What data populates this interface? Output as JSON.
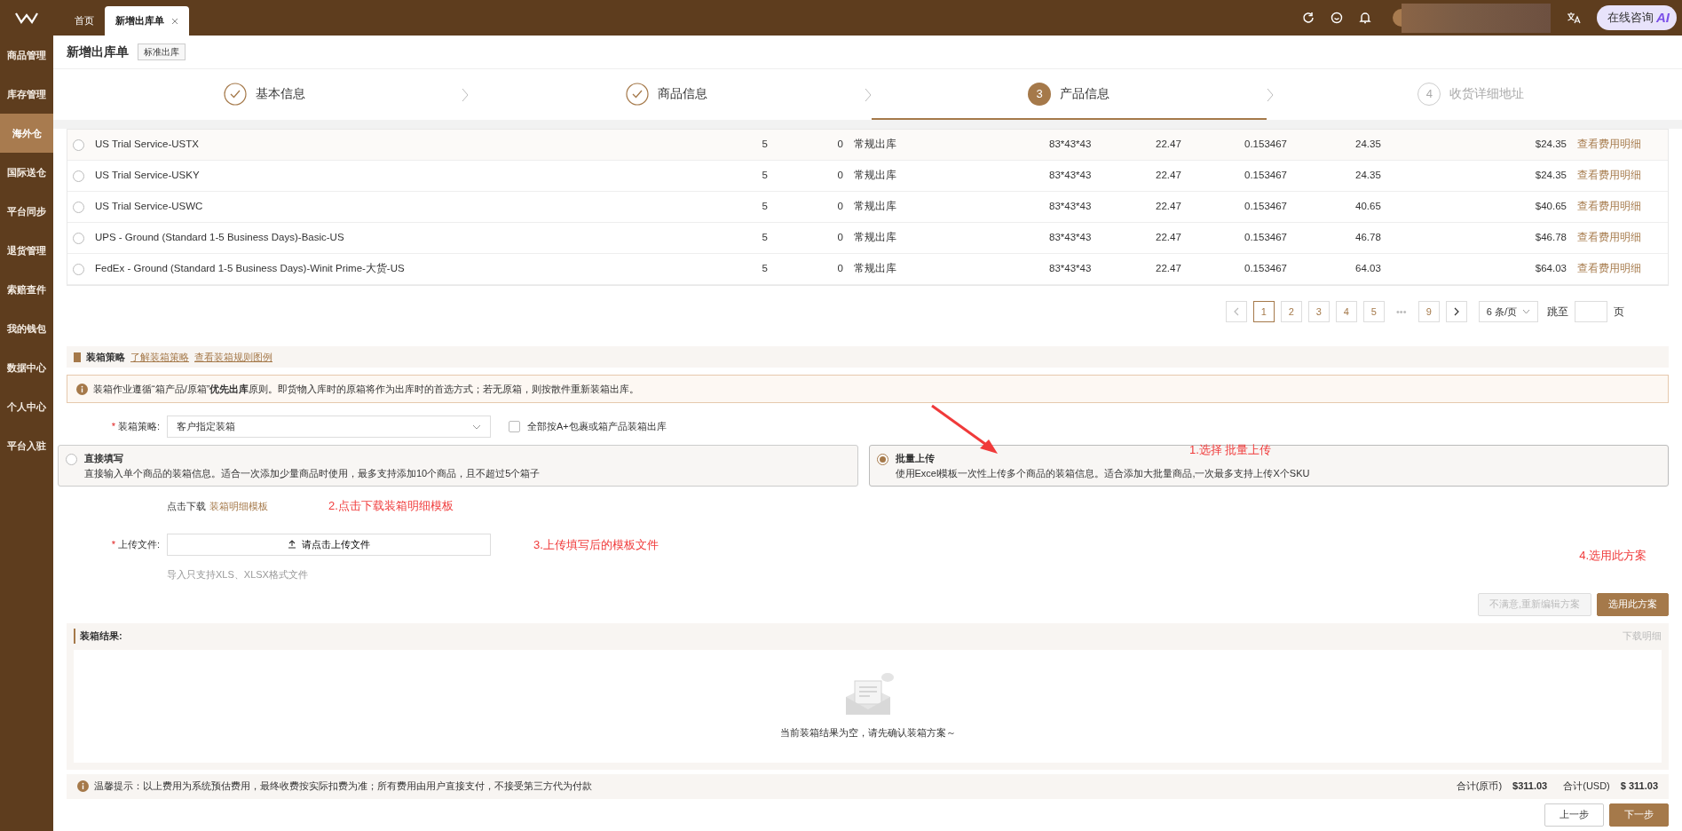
{
  "tabs": [
    {
      "label": "首页",
      "selected": false,
      "closable": false
    },
    {
      "label": "新增出库单",
      "selected": true,
      "closable": true
    }
  ],
  "ai_button": {
    "label": "在线咨询",
    "badge": "AI"
  },
  "sidebar": {
    "items": [
      {
        "label": "商品管理",
        "selected": false
      },
      {
        "label": "库存管理",
        "selected": false
      },
      {
        "label": "海外仓",
        "selected": true
      },
      {
        "label": "国际送仓",
        "selected": false
      },
      {
        "label": "平台同步",
        "selected": false
      },
      {
        "label": "退货管理",
        "selected": false
      },
      {
        "label": "索赔查件",
        "selected": false
      },
      {
        "label": "我的钱包",
        "selected": false
      },
      {
        "label": "数据中心",
        "selected": false
      },
      {
        "label": "个人中心",
        "selected": false
      },
      {
        "label": "平台入驻",
        "selected": false
      }
    ]
  },
  "page": {
    "title": "新增出库单",
    "tag": "标准出库"
  },
  "steps": [
    {
      "label": "基本信息",
      "done": true,
      "active": false
    },
    {
      "label": "商品信息",
      "done": true,
      "active": false
    },
    {
      "label": "产品信息",
      "number": "3",
      "done": false,
      "active": true
    },
    {
      "label": "收货详细地址",
      "number": "4",
      "done": false,
      "active": false
    }
  ],
  "table": {
    "rows": [
      {
        "selected": false,
        "cells": [
          "US Trial Service-USTX",
          "5",
          "0",
          "常规出库",
          "83*43*43",
          "22.47",
          "0.153467",
          "24.35",
          "$24.35"
        ],
        "link": "查看费用明细"
      },
      {
        "selected": false,
        "cells": [
          "US Trial Service-USKY",
          "5",
          "0",
          "常规出库",
          "83*43*43",
          "22.47",
          "0.153467",
          "24.35",
          "$24.35"
        ],
        "link": "查看费用明细"
      },
      {
        "selected": false,
        "cells": [
          "US Trial Service-USWC",
          "5",
          "0",
          "常规出库",
          "83*43*43",
          "22.47",
          "0.153467",
          "40.65",
          "$40.65"
        ],
        "link": "查看费用明细"
      },
      {
        "selected": false,
        "cells": [
          "UPS - Ground (Standard 1-5 Business Days)-Basic-US",
          "5",
          "0",
          "常规出库",
          "83*43*43",
          "22.47",
          "0.153467",
          "46.78",
          "$46.78"
        ],
        "link": "查看费用明细"
      },
      {
        "selected": false,
        "cells": [
          "FedEx - Ground (Standard 1-5 Business Days)-Winit Prime-大货-US",
          "5",
          "0",
          "常规出库",
          "83*43*43",
          "22.47",
          "0.153467",
          "64.03",
          "$64.03"
        ],
        "link": "查看费用明细"
      }
    ]
  },
  "pagination": {
    "pages": [
      {
        "label": "1",
        "selected": true
      },
      {
        "label": "2",
        "selected": false
      },
      {
        "label": "3",
        "selected": false
      },
      {
        "label": "4",
        "selected": false
      },
      {
        "label": "5",
        "selected": false
      },
      {
        "label": "•••",
        "kind": "ellipsis"
      },
      {
        "label": "9",
        "selected": false
      }
    ],
    "page_size": "6 条/页",
    "jump_label": "跳至",
    "jump_suffix": "页"
  },
  "packing": {
    "title": "装箱策略",
    "links": [
      "了解装箱策略",
      "查看装箱规则图例"
    ],
    "notice": "装箱作业遵循“箱产品/原箱”**优先出库**原则。即货物入库时的原箱将作为出库时的首选方式；若无原箱，则按散件重新装箱出库。",
    "required_mark": "*",
    "strategy_label": "装箱策略:",
    "strategy_value": "客户指定装箱",
    "checkbox": {
      "label": "全部按A+包裹或箱产品装箱出库",
      "checked": false
    },
    "options": [
      {
        "title": "直接填写",
        "desc": "直接输入单个商品的装箱信息。适合一次添加少量商品时使用，最多支持添加10个商品，且不超过5个箱子",
        "selected": false
      },
      {
        "title": "批量上传",
        "desc": "使用Excel模板一次性上传多个商品的装箱信息。适合添加大批量商品,一次最多支持上传X个SKU",
        "selected": true
      }
    ],
    "download_prefix": "点击下载",
    "download_link": "装箱明细模板",
    "upload_label": "上传文件:",
    "upload_button": "请点击上传文件",
    "upload_hint": "导入只支持XLS、XLSX格式文件",
    "buttons": [
      {
        "label": "不满意,重新编辑方案",
        "disabled": true
      },
      {
        "label": "选用此方案",
        "disabled": false
      }
    ]
  },
  "result": {
    "title": "装箱结果:",
    "download": "下载明细",
    "empty": "当前装箱结果为空，请先确认装箱方案～"
  },
  "footer": {
    "tip": "温馨提示：以上费用为系统预估费用，最终收费按实际扣费为准；所有费用由用户直接支付，不接受第三方代为付款",
    "totals": [
      {
        "label": "合计(原币)",
        "value": "$311.03"
      },
      {
        "label": "合计(USD)",
        "value": "$ 311.03"
      }
    ],
    "buttons": [
      {
        "label": "上一步",
        "kind": "outline"
      },
      {
        "label": "下一步",
        "kind": "primary"
      }
    ]
  },
  "annotations": [
    "1.选择 批量上传",
    "2.点击下载装箱明细模板",
    "3.上传填写后的模板文件",
    "4.选用此方案"
  ]
}
